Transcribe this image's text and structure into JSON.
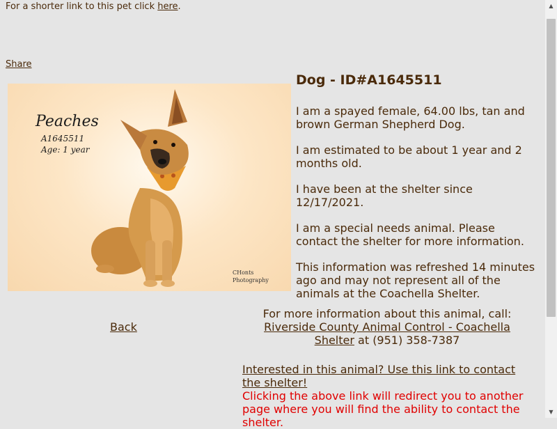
{
  "top": {
    "prefix": "For a shorter link to this pet click ",
    "link": "here",
    "suffix": "."
  },
  "share": "Share",
  "photo": {
    "name": "Peaches",
    "id_text": "A1645511",
    "age_text": "Age: 1 year",
    "credit_line1": "CHonts",
    "credit_line2": "Photography"
  },
  "title": "Dog - ID#A1645511",
  "description": [
    "I am a spayed female, 64.00 lbs, tan and brown German Shepherd Dog.",
    "I am estimated to be about 1 year and 2 months old.",
    "I have been at the shelter since 12/17/2021.",
    "I am a special needs animal. Please contact the shelter for more information.",
    "This information was refreshed 14 minutes ago and may not represent all of the animals at the Coachella Shelter."
  ],
  "back": "Back",
  "contact": {
    "intro": "For more information about this animal, call:",
    "shelter_link": "Riverside County Animal Control - Coachella Shelter",
    "phone": " at (951) 358-7387"
  },
  "interest": {
    "link": "Interested in this animal? Use this link to contact the shelter!",
    "note": "Clicking the above link will redirect you to another page where you will find the ability to contact the shelter."
  },
  "icons": {
    "scroll_up": "scroll-up-arrow",
    "scroll_down": "scroll-down-arrow"
  }
}
